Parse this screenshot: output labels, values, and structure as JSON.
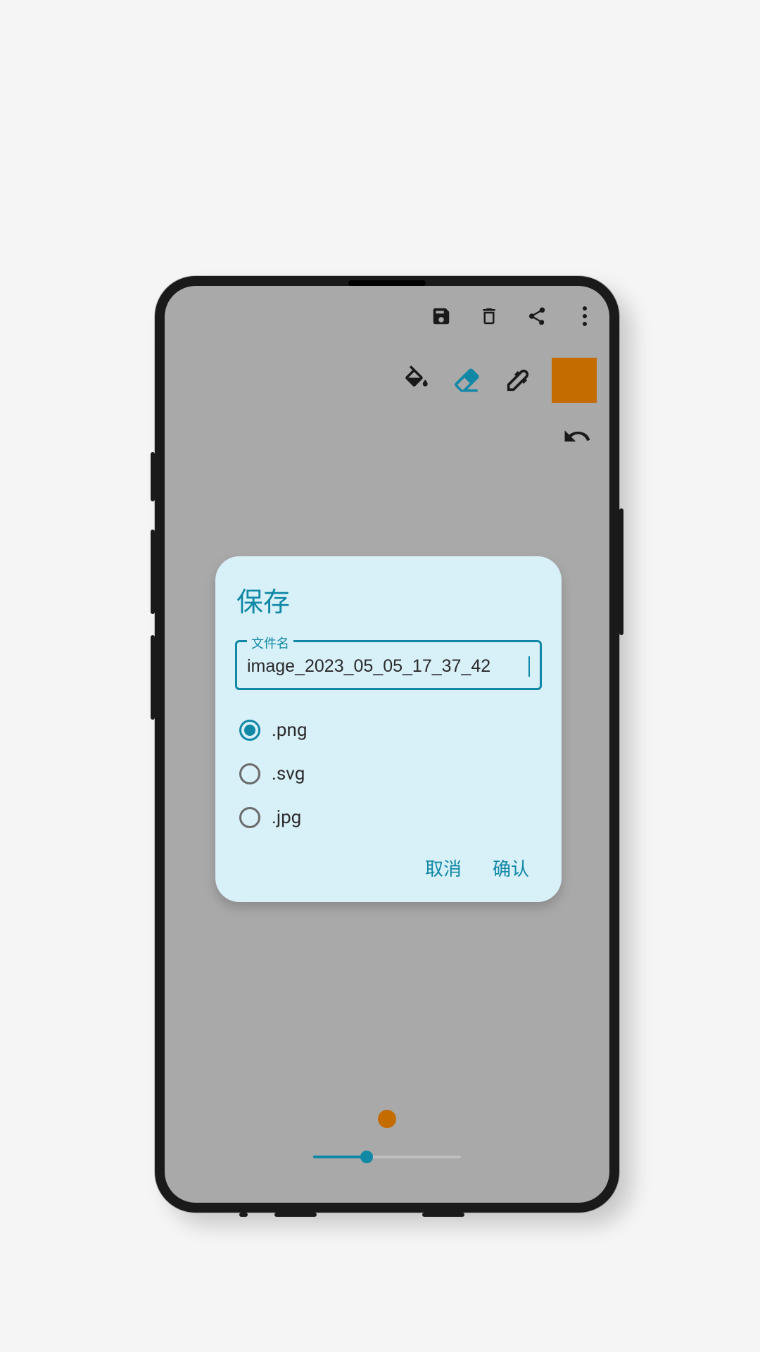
{
  "toolbar": {
    "save_icon": "save",
    "delete_icon": "delete",
    "share_icon": "share",
    "overflow_icon": "more"
  },
  "tools": {
    "fill_icon": "fill",
    "eraser_icon": "eraser",
    "eyedropper_icon": "eyedropper",
    "swatch_color": "#c46c00",
    "undo_icon": "undo"
  },
  "brush": {
    "preview_color": "#c46c00",
    "slider_value": 35
  },
  "dialog": {
    "title": "保存",
    "field_label": "文件名",
    "filename": "image_2023_05_05_17_37_42",
    "formats": [
      {
        "label": ".png",
        "selected": true
      },
      {
        "label": ".svg",
        "selected": false
      },
      {
        "label": ".jpg",
        "selected": false
      }
    ],
    "cancel": "取消",
    "confirm": "确认"
  }
}
